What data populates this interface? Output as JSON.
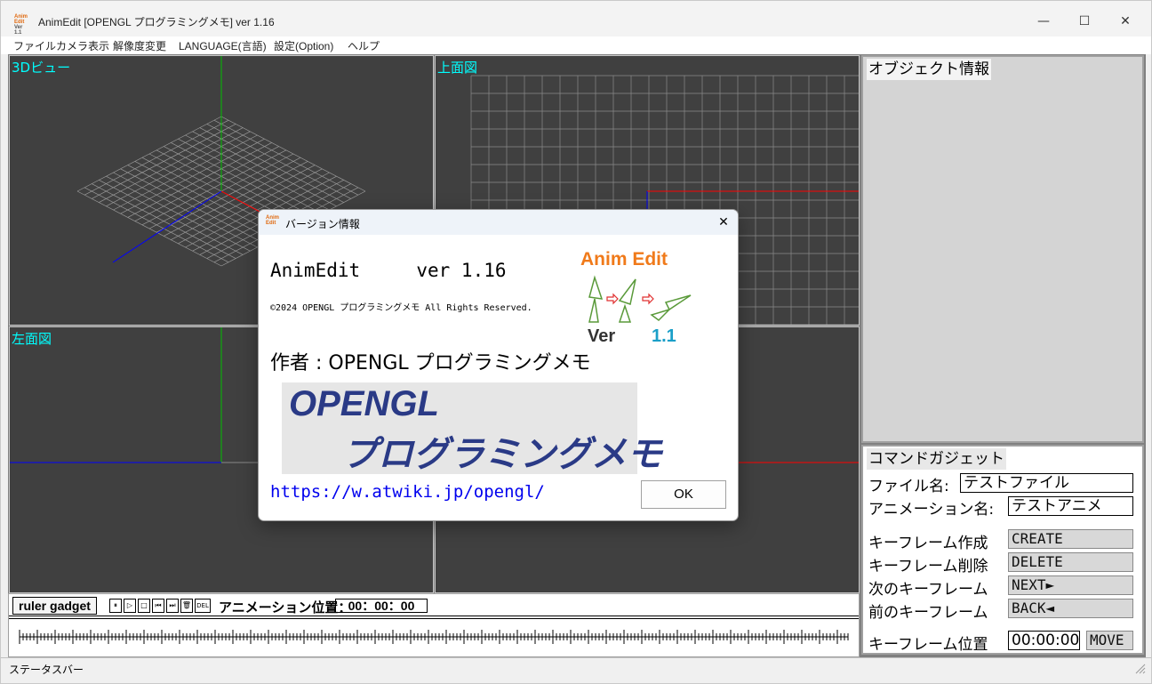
{
  "window": {
    "title": "AnimEdit [OPENGL プログラミングメモ] ver 1.16",
    "icon_text_top": "Anim",
    "icon_text_mid": "Edit",
    "icon_text_bottom": "Ver 1.1",
    "minimize": "—",
    "maximize": "☐",
    "close": "✕"
  },
  "menu": {
    "items": [
      "ファイル",
      "カメラ表示",
      "解像度変更",
      "LANGUAGE(言語)",
      "設定(Option)",
      "ヘルプ"
    ]
  },
  "viewports": {
    "v3d": "3Dビュー",
    "top": "上面図",
    "left": "左面図"
  },
  "object_panel": {
    "header": "オブジェクト情報"
  },
  "command_gadget": {
    "header": "コマンドガジェット",
    "file_label": "ファイル名:",
    "file_value": "テストファイル",
    "anim_label": "アニメーション名:",
    "anim_value": "テストアニメ",
    "create_label": "キーフレーム作成",
    "create_btn": "CREATE",
    "delete_label": "キーフレーム削除",
    "delete_btn": "DELETE",
    "next_label": "次のキーフレーム",
    "next_btn": "NEXT►",
    "back_label": "前のキーフレーム",
    "back_btn": "BACK◄",
    "pos_label": "キーフレーム位置",
    "pos_value": "00:00:00",
    "move_btn": "MOVE"
  },
  "ruler": {
    "label": "ruler gadget",
    "buttons": [
      "⏸",
      "▷",
      "□",
      "⏮",
      "⏭",
      "🗑",
      "DEL"
    ],
    "anim_pos_label": "アニメーション位置：",
    "anim_pos_value": "00：00：00"
  },
  "status": {
    "text": "ステータスバー"
  },
  "dialog": {
    "title": "バージョン情報",
    "close": "✕",
    "app_line": "AnimEdit     ver 1.16",
    "copyright": "©2024 OPENGL プログラミングメモ All Rights Reserved.",
    "author": "作者 : OPENGL プログラミングメモ",
    "banner_line1": "OPENGL",
    "banner_line2": "プログラミングメモ",
    "url": "https://w.atwiki.jp/opengl/",
    "ok": "OK",
    "logo_title": "Anim Edit",
    "logo_ver": "Ver",
    "logo_num": "1.1",
    "colors": {
      "logo_orange": "#f07a1a",
      "logo_blue": "#1a9fc8",
      "logo_green": "#5a9a3a",
      "link": "#0000ee"
    }
  },
  "colors": {
    "viewport_bg": "#404040",
    "viewport_label": "#00ffff",
    "axis_red": "#ff0000",
    "axis_green": "#00c000",
    "axis_blue": "#0000ff"
  }
}
